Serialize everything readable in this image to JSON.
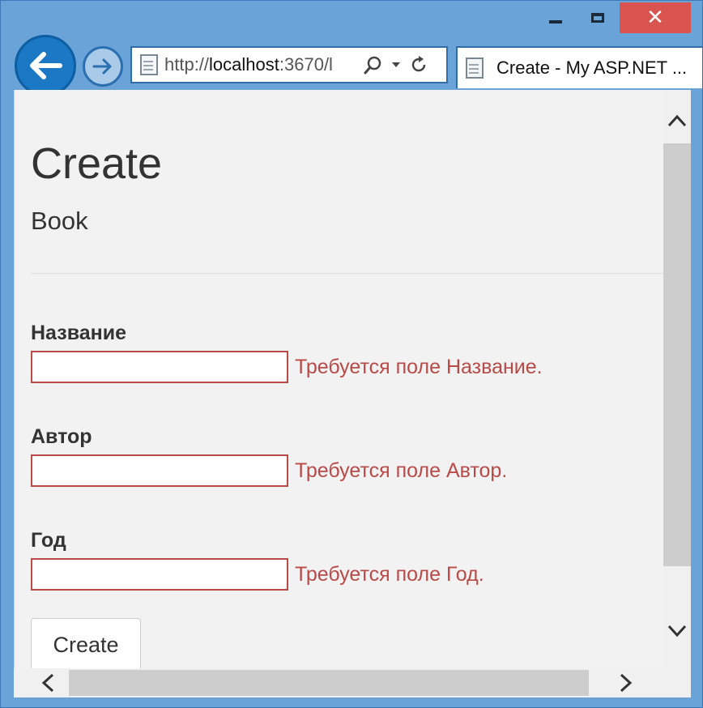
{
  "browser": {
    "url_prefix": "http://",
    "url_host": "localhost",
    "url_rest": ":3670/l",
    "tab_title": "Create - My ASP.NET ..."
  },
  "page": {
    "title": "Create",
    "subtitle": "Book"
  },
  "form": {
    "fields": [
      {
        "label": "Название",
        "value": "",
        "error": "Требуется поле Название."
      },
      {
        "label": "Автор",
        "value": "",
        "error": "Требуется поле Автор."
      },
      {
        "label": "Год",
        "value": "",
        "error": "Требуется поле Год."
      }
    ],
    "submit_label": "Create"
  },
  "colors": {
    "error": "#b94a48",
    "accent": "#1b78c5",
    "close": "#d9534f"
  },
  "icons": {
    "back": "arrow-left-icon",
    "forward": "arrow-right-icon",
    "search": "search-icon",
    "refresh": "refresh-icon",
    "minimize": "minimize-icon",
    "maximize": "maximize-icon",
    "close": "close-icon"
  }
}
